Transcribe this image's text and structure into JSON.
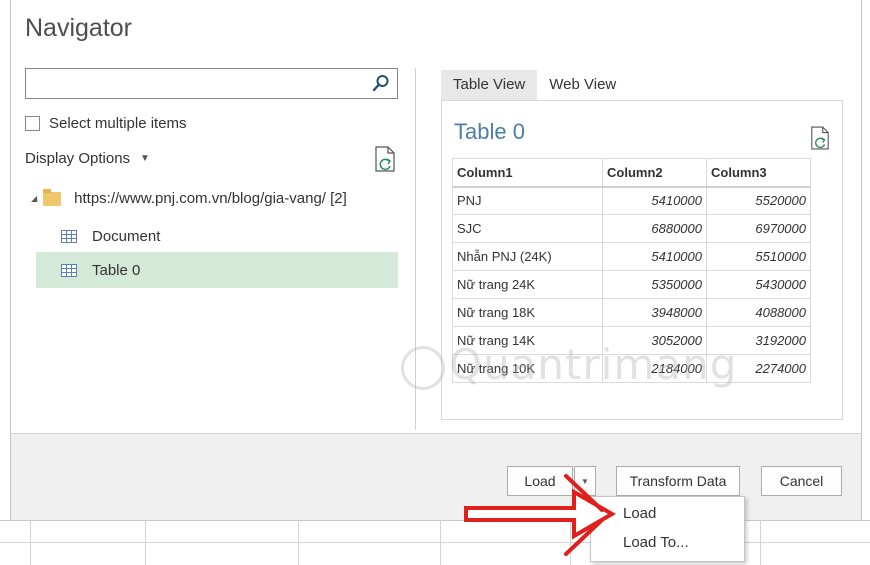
{
  "window": {
    "title": "Navigator"
  },
  "search": {
    "placeholder": "",
    "value": ""
  },
  "select_multiple_label": "Select multiple items",
  "display_options_label": "Display Options",
  "tree": {
    "root_label": "https://www.pnj.com.vn/blog/gia-vang/ [2]",
    "items": [
      {
        "label": "Document",
        "selected": false
      },
      {
        "label": "Table 0",
        "selected": true
      }
    ]
  },
  "tabs": [
    {
      "label": "Table View",
      "active": true
    },
    {
      "label": "Web View",
      "active": false
    }
  ],
  "preview": {
    "title": "Table 0",
    "columns": [
      "Column1",
      "Column2",
      "Column3"
    ],
    "rows": [
      [
        "PNJ",
        "5410000",
        "5520000"
      ],
      [
        "SJC",
        "6880000",
        "6970000"
      ],
      [
        "Nhẫn PNJ (24K)",
        "5410000",
        "5510000"
      ],
      [
        "Nữ trang 24K",
        "5350000",
        "5430000"
      ],
      [
        "Nữ trang 18K",
        "3948000",
        "4088000"
      ],
      [
        "Nữ trang 14K",
        "3052000",
        "3192000"
      ],
      [
        "Nữ trang 10K",
        "2184000",
        "2274000"
      ]
    ]
  },
  "watermark": "Quantrimang",
  "buttons": {
    "load": "Load",
    "transform": "Transform Data",
    "cancel": "Cancel"
  },
  "dropdown_menu": {
    "items": [
      "Load",
      "Load To..."
    ]
  },
  "colors": {
    "selected_row": "#d5e9d9",
    "preview_title": "#4a7fa7",
    "arrow_red": "#e0201a"
  }
}
